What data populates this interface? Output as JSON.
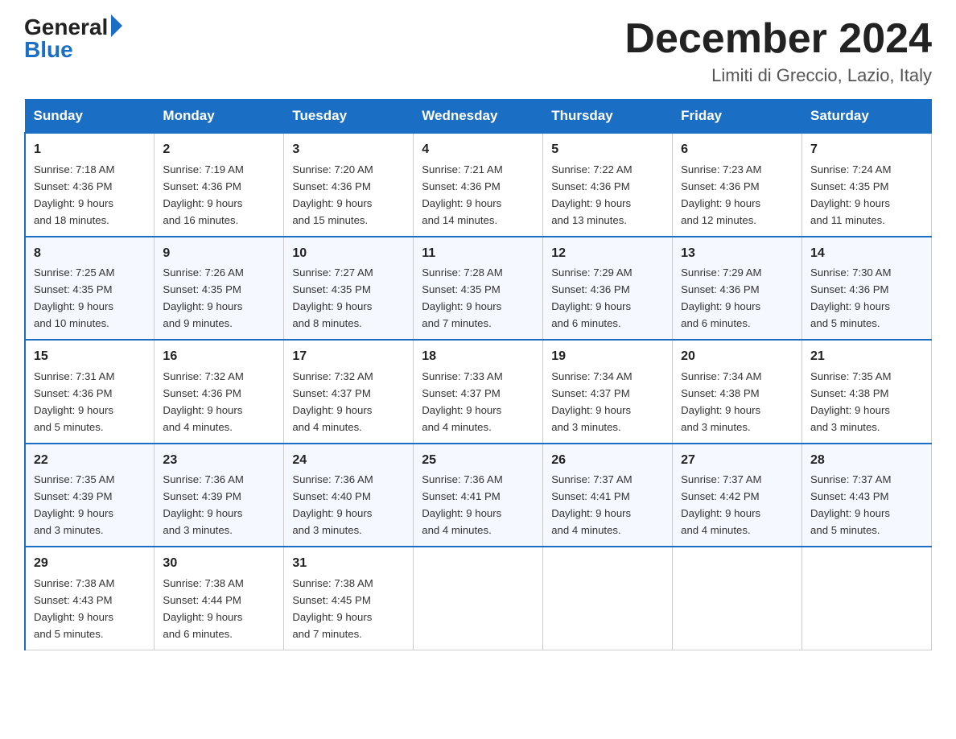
{
  "header": {
    "logo_general": "General",
    "logo_blue": "Blue",
    "month_title": "December 2024",
    "location": "Limiti di Greccio, Lazio, Italy"
  },
  "days_of_week": [
    "Sunday",
    "Monday",
    "Tuesday",
    "Wednesday",
    "Thursday",
    "Friday",
    "Saturday"
  ],
  "weeks": [
    [
      {
        "num": "1",
        "sunrise": "7:18 AM",
        "sunset": "4:36 PM",
        "daylight": "9 hours and 18 minutes."
      },
      {
        "num": "2",
        "sunrise": "7:19 AM",
        "sunset": "4:36 PM",
        "daylight": "9 hours and 16 minutes."
      },
      {
        "num": "3",
        "sunrise": "7:20 AM",
        "sunset": "4:36 PM",
        "daylight": "9 hours and 15 minutes."
      },
      {
        "num": "4",
        "sunrise": "7:21 AM",
        "sunset": "4:36 PM",
        "daylight": "9 hours and 14 minutes."
      },
      {
        "num": "5",
        "sunrise": "7:22 AM",
        "sunset": "4:36 PM",
        "daylight": "9 hours and 13 minutes."
      },
      {
        "num": "6",
        "sunrise": "7:23 AM",
        "sunset": "4:36 PM",
        "daylight": "9 hours and 12 minutes."
      },
      {
        "num": "7",
        "sunrise": "7:24 AM",
        "sunset": "4:35 PM",
        "daylight": "9 hours and 11 minutes."
      }
    ],
    [
      {
        "num": "8",
        "sunrise": "7:25 AM",
        "sunset": "4:35 PM",
        "daylight": "9 hours and 10 minutes."
      },
      {
        "num": "9",
        "sunrise": "7:26 AM",
        "sunset": "4:35 PM",
        "daylight": "9 hours and 9 minutes."
      },
      {
        "num": "10",
        "sunrise": "7:27 AM",
        "sunset": "4:35 PM",
        "daylight": "9 hours and 8 minutes."
      },
      {
        "num": "11",
        "sunrise": "7:28 AM",
        "sunset": "4:35 PM",
        "daylight": "9 hours and 7 minutes."
      },
      {
        "num": "12",
        "sunrise": "7:29 AM",
        "sunset": "4:36 PM",
        "daylight": "9 hours and 6 minutes."
      },
      {
        "num": "13",
        "sunrise": "7:29 AM",
        "sunset": "4:36 PM",
        "daylight": "9 hours and 6 minutes."
      },
      {
        "num": "14",
        "sunrise": "7:30 AM",
        "sunset": "4:36 PM",
        "daylight": "9 hours and 5 minutes."
      }
    ],
    [
      {
        "num": "15",
        "sunrise": "7:31 AM",
        "sunset": "4:36 PM",
        "daylight": "9 hours and 5 minutes."
      },
      {
        "num": "16",
        "sunrise": "7:32 AM",
        "sunset": "4:36 PM",
        "daylight": "9 hours and 4 minutes."
      },
      {
        "num": "17",
        "sunrise": "7:32 AM",
        "sunset": "4:37 PM",
        "daylight": "9 hours and 4 minutes."
      },
      {
        "num": "18",
        "sunrise": "7:33 AM",
        "sunset": "4:37 PM",
        "daylight": "9 hours and 4 minutes."
      },
      {
        "num": "19",
        "sunrise": "7:34 AM",
        "sunset": "4:37 PM",
        "daylight": "9 hours and 3 minutes."
      },
      {
        "num": "20",
        "sunrise": "7:34 AM",
        "sunset": "4:38 PM",
        "daylight": "9 hours and 3 minutes."
      },
      {
        "num": "21",
        "sunrise": "7:35 AM",
        "sunset": "4:38 PM",
        "daylight": "9 hours and 3 minutes."
      }
    ],
    [
      {
        "num": "22",
        "sunrise": "7:35 AM",
        "sunset": "4:39 PM",
        "daylight": "9 hours and 3 minutes."
      },
      {
        "num": "23",
        "sunrise": "7:36 AM",
        "sunset": "4:39 PM",
        "daylight": "9 hours and 3 minutes."
      },
      {
        "num": "24",
        "sunrise": "7:36 AM",
        "sunset": "4:40 PM",
        "daylight": "9 hours and 3 minutes."
      },
      {
        "num": "25",
        "sunrise": "7:36 AM",
        "sunset": "4:41 PM",
        "daylight": "9 hours and 4 minutes."
      },
      {
        "num": "26",
        "sunrise": "7:37 AM",
        "sunset": "4:41 PM",
        "daylight": "9 hours and 4 minutes."
      },
      {
        "num": "27",
        "sunrise": "7:37 AM",
        "sunset": "4:42 PM",
        "daylight": "9 hours and 4 minutes."
      },
      {
        "num": "28",
        "sunrise": "7:37 AM",
        "sunset": "4:43 PM",
        "daylight": "9 hours and 5 minutes."
      }
    ],
    [
      {
        "num": "29",
        "sunrise": "7:38 AM",
        "sunset": "4:43 PM",
        "daylight": "9 hours and 5 minutes."
      },
      {
        "num": "30",
        "sunrise": "7:38 AM",
        "sunset": "4:44 PM",
        "daylight": "9 hours and 6 minutes."
      },
      {
        "num": "31",
        "sunrise": "7:38 AM",
        "sunset": "4:45 PM",
        "daylight": "9 hours and 7 minutes."
      },
      null,
      null,
      null,
      null
    ]
  ],
  "labels": {
    "sunrise": "Sunrise:",
    "sunset": "Sunset:",
    "daylight": "Daylight:"
  }
}
